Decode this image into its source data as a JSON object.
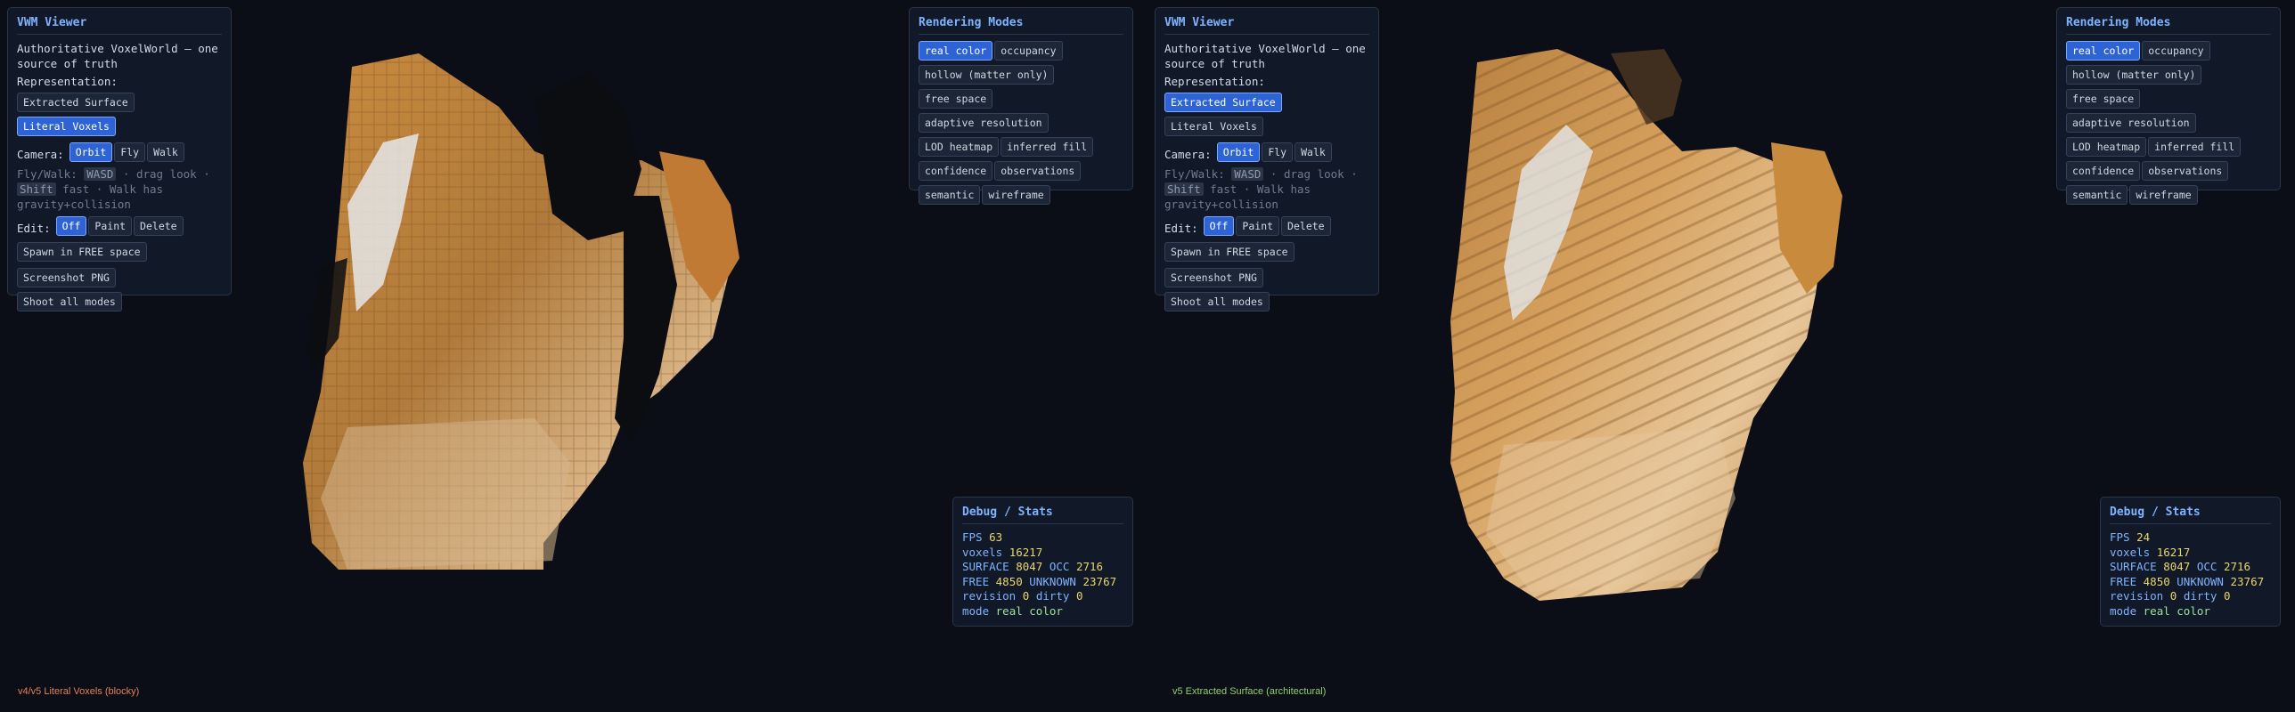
{
  "panes": [
    {
      "main_panel": {
        "title": "VWM Viewer",
        "description": "Authoritative VoxelWorld — one source of truth",
        "representation_label": "Representation:",
        "representation_options": [
          {
            "label": "Extracted Surface",
            "active": false
          },
          {
            "label": "Literal Voxels",
            "active": true
          }
        ],
        "camera_label": "Camera:",
        "camera_options": [
          {
            "label": "Orbit",
            "active": true
          },
          {
            "label": "Fly",
            "active": false
          },
          {
            "label": "Walk",
            "active": false
          }
        ],
        "help_prefix": "Fly/Walk:",
        "help_key1": "WASD",
        "help_mid": " · drag look ·",
        "help_key2": "Shift",
        "help_suffix": " fast · Walk has gravity+collision",
        "edit_label": "Edit:",
        "edit_options": [
          {
            "label": "Off",
            "active": true
          },
          {
            "label": "Paint",
            "active": false
          },
          {
            "label": "Delete",
            "active": false
          }
        ],
        "spawn_button": "Spawn in FREE space",
        "screenshot_button": "Screenshot PNG",
        "shoot_all_button": "Shoot all modes"
      },
      "modes_panel": {
        "title": "Rendering Modes",
        "modes": [
          {
            "label": "real color",
            "active": true
          },
          {
            "label": "occupancy",
            "active": false
          },
          {
            "label": "hollow (matter only)",
            "active": false
          },
          {
            "label": "free space",
            "active": false
          },
          {
            "label": "adaptive resolution",
            "active": false
          },
          {
            "label": "LOD heatmap",
            "active": false
          },
          {
            "label": "inferred fill",
            "active": false
          },
          {
            "label": "confidence",
            "active": false
          },
          {
            "label": "observations",
            "active": false
          },
          {
            "label": "semantic",
            "active": false
          },
          {
            "label": "wireframe",
            "active": false
          }
        ]
      },
      "stats": {
        "title": "Debug / Stats",
        "fps_label": "FPS",
        "fps": "63",
        "voxels_label": "voxels",
        "voxels": "16217",
        "surface_label": "SURFACE",
        "surface": "8047",
        "occ_label": "OCC",
        "occ": "2716",
        "free_label": "FREE",
        "free": "4850",
        "unknown_label": "UNKNOWN",
        "unknown": "23767",
        "revision_label": "revision",
        "revision": "0",
        "dirty_label": "dirty",
        "dirty": "0",
        "mode_label": "mode",
        "mode": "real color"
      },
      "caption": "v4/v5 Literal Voxels (blocky)"
    },
    {
      "main_panel": {
        "title": "VWM Viewer",
        "description": "Authoritative VoxelWorld — one source of truth",
        "representation_label": "Representation:",
        "representation_options": [
          {
            "label": "Extracted Surface",
            "active": true
          },
          {
            "label": "Literal Voxels",
            "active": false
          }
        ],
        "camera_label": "Camera:",
        "camera_options": [
          {
            "label": "Orbit",
            "active": true
          },
          {
            "label": "Fly",
            "active": false
          },
          {
            "label": "Walk",
            "active": false
          }
        ],
        "help_prefix": "Fly/Walk:",
        "help_key1": "WASD",
        "help_mid": " · drag look ·",
        "help_key2": "Shift",
        "help_suffix": " fast · Walk has gravity+collision",
        "edit_label": "Edit:",
        "edit_options": [
          {
            "label": "Off",
            "active": true
          },
          {
            "label": "Paint",
            "active": false
          },
          {
            "label": "Delete",
            "active": false
          }
        ],
        "spawn_button": "Spawn in FREE space",
        "screenshot_button": "Screenshot PNG",
        "shoot_all_button": "Shoot all modes"
      },
      "modes_panel": {
        "title": "Rendering Modes",
        "modes": [
          {
            "label": "real color",
            "active": true
          },
          {
            "label": "occupancy",
            "active": false
          },
          {
            "label": "hollow (matter only)",
            "active": false
          },
          {
            "label": "free space",
            "active": false
          },
          {
            "label": "adaptive resolution",
            "active": false
          },
          {
            "label": "LOD heatmap",
            "active": false
          },
          {
            "label": "inferred fill",
            "active": false
          },
          {
            "label": "confidence",
            "active": false
          },
          {
            "label": "observations",
            "active": false
          },
          {
            "label": "semantic",
            "active": false
          },
          {
            "label": "wireframe",
            "active": false
          }
        ]
      },
      "stats": {
        "title": "Debug / Stats",
        "fps_label": "FPS",
        "fps": "24",
        "voxels_label": "voxels",
        "voxels": "16217",
        "surface_label": "SURFACE",
        "surface": "8047",
        "occ_label": "OCC",
        "occ": "2716",
        "free_label": "FREE",
        "free": "4850",
        "unknown_label": "UNKNOWN",
        "unknown": "23767",
        "revision_label": "revision",
        "revision": "0",
        "dirty_label": "dirty",
        "dirty": "0",
        "mode_label": "mode",
        "mode": "real color"
      },
      "caption": "v5 Extracted Surface (architectural)"
    }
  ],
  "colors": {
    "background": "#0b0e16",
    "panel": "#111827",
    "accent": "#2e63d6",
    "title": "#7fb3ff",
    "value": "#e9d66b",
    "mode_value": "#9be39b",
    "caption_left": "#e0805a",
    "caption_right": "#8fd16b"
  }
}
